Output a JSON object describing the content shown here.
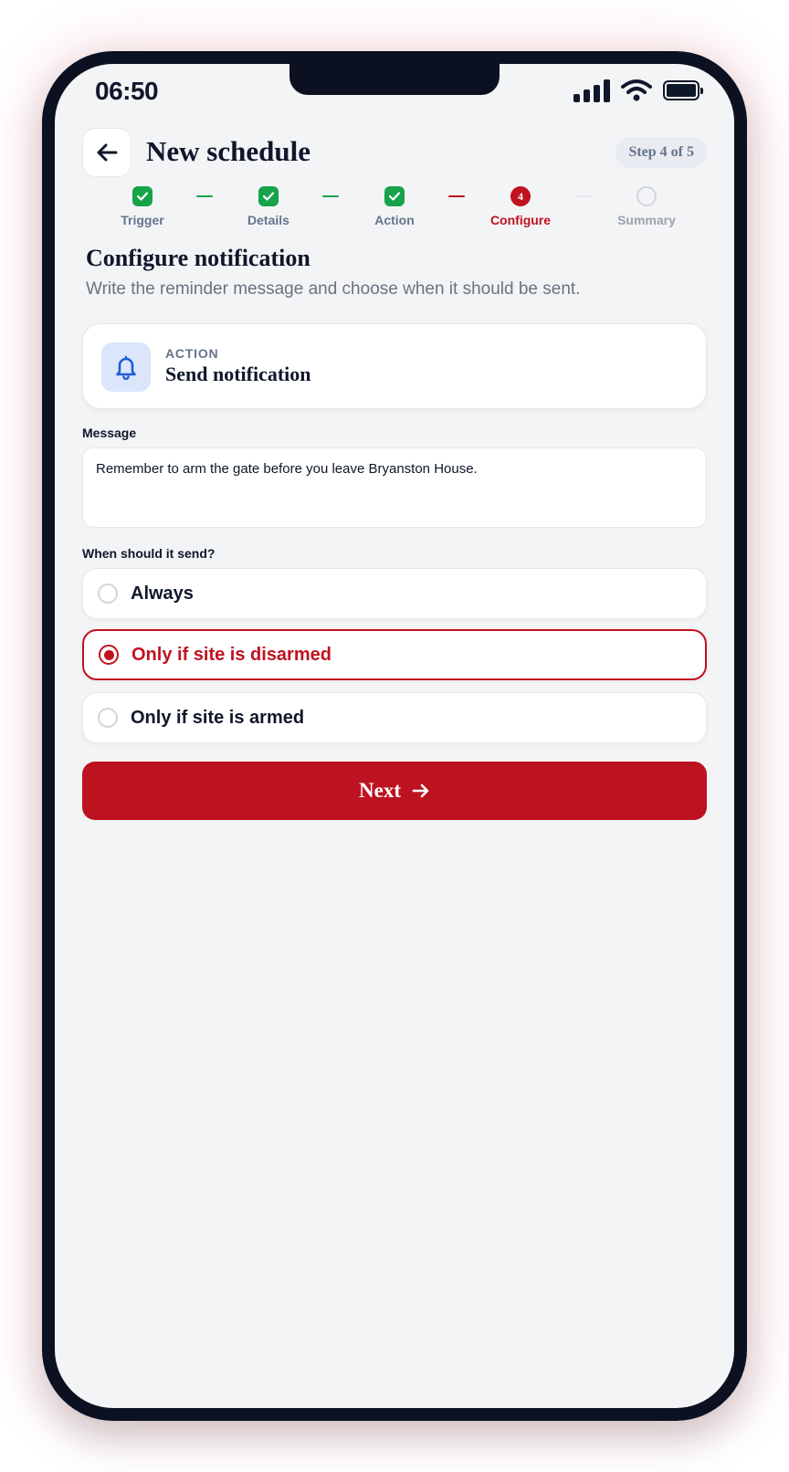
{
  "status_bar": {
    "time": "06:50",
    "icons": [
      "cellular-signal-icon",
      "wifi-icon",
      "battery-icon"
    ]
  },
  "header": {
    "back_icon": "arrow-left-icon",
    "title": "New schedule",
    "step_indicator": "Step 4 of 5"
  },
  "stepper": {
    "steps": [
      {
        "label": "Trigger",
        "state": "done"
      },
      {
        "label": "Details",
        "state": "done"
      },
      {
        "label": "Action",
        "state": "done"
      },
      {
        "label": "Configure",
        "state": "current",
        "number": "4"
      },
      {
        "label": "Summary",
        "state": "pending"
      }
    ]
  },
  "section": {
    "title": "Configure notification",
    "subtitle": "Write the reminder message and choose when it should be sent."
  },
  "action_card": {
    "icon": "bell-icon",
    "eyebrow": "ACTION",
    "name": "Send notification"
  },
  "message": {
    "label": "Message",
    "value": "Remember to arm the gate before you leave Bryanston House."
  },
  "send_condition": {
    "label": "When should it send?",
    "options": [
      {
        "label": "Always",
        "selected": false
      },
      {
        "label": "Only if site is disarmed",
        "selected": true
      },
      {
        "label": "Only if site is armed",
        "selected": false
      }
    ]
  },
  "next_button": {
    "label": "Next",
    "icon": "arrow-right-icon"
  },
  "colors": {
    "accent_red": "#c0121f",
    "done_green": "#16a34a",
    "text_dark": "#0f172a",
    "muted": "#64748b",
    "background": "#f3f4f6"
  }
}
